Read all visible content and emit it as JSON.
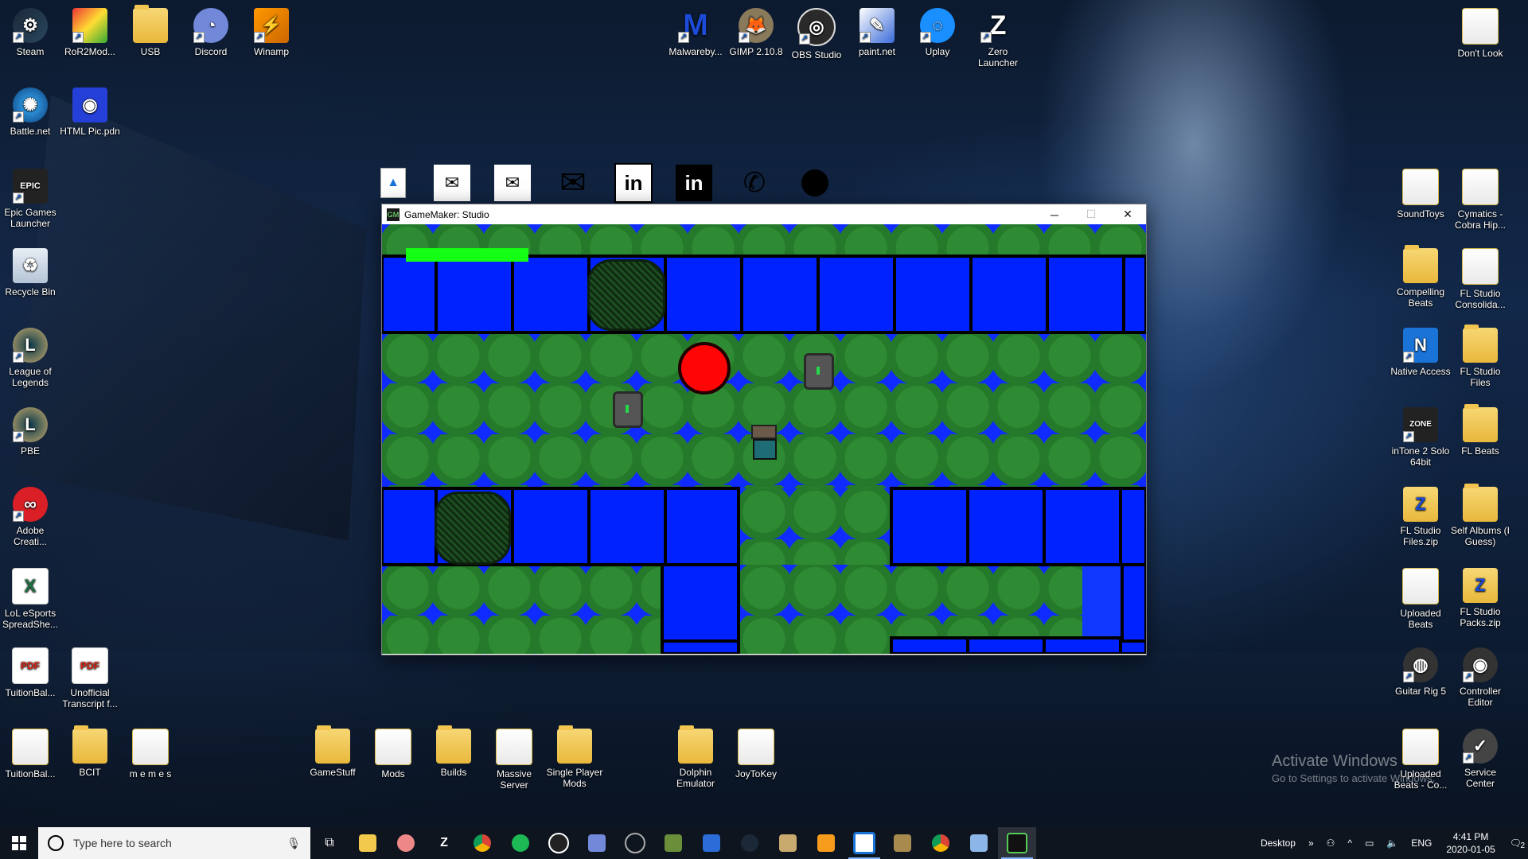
{
  "desktop_icons": {
    "steam": "Steam",
    "ror2mod": "RoR2Mod...",
    "usb": "USB",
    "discord": "Discord",
    "winamp": "Winamp",
    "malwarebytes": "Malwareby...",
    "gimp": "GIMP 2.10.8",
    "obs": "OBS Studio",
    "paintnet": "paint.net",
    "uplay": "Uplay",
    "zero_launcher": "Zero Launcher",
    "dont_look": "Don't Look",
    "battlenet": "Battle.net",
    "html_pic": "HTML Pic.pdn",
    "epic": "Epic Games Launcher",
    "recycle": "Recycle Bin",
    "lol": "League of Legends",
    "pbe": "PBE",
    "adobe": "Adobe Creati...",
    "lol_esports": "LoL eSports SpreadShe...",
    "tuition_pdf": "TuitionBal...",
    "unofficial_transcript": "Unofficial Transcript f...",
    "tuition_bottom": "TuitionBal...",
    "bcit": "BCIT",
    "memes": "m e m e s",
    "gamestuff": "GameStuff",
    "mods": "Mods",
    "builds": "Builds",
    "massive_server": "Massive Server",
    "single_player_mods": "Single Player Mods",
    "dolphin": "Dolphin Emulator",
    "joytokey": "JoyToKey",
    "soundtoys": "SoundToys",
    "cymatics": "Cymatics - Cobra Hip...",
    "compelling_beats": "Compelling Beats",
    "fl_consolidated": "FL Studio Consolida...",
    "native_access": "Native Access",
    "fl_files": "FL Studio Files",
    "intone": "inTone 2 Solo 64bit",
    "fl_beats": "FL Beats",
    "fl_files_zip": "FL Studio Files.zip",
    "self_albums": "Self Albums (I Guess)",
    "uploaded_beats": "Uploaded Beats",
    "fl_packs_zip": "FL Studio Packs.zip",
    "guitar_rig": "Guitar Rig 5",
    "controller_editor": "Controller Editor",
    "uploaded_beats_co": "Uploaded Beats - Co...",
    "service_center": "Service Center"
  },
  "window": {
    "title": "GameMaker: Studio",
    "minimize": "─",
    "maximize": "☐",
    "close": "✕"
  },
  "game": {
    "health_fraction": 1.0,
    "colors": {
      "health": "#14ff14",
      "water": "#0022ff",
      "grass": "#2e8b33",
      "enemy": "#ff0505"
    }
  },
  "taskbar": {
    "search_placeholder": "Type here to search",
    "desktop_label": "Desktop",
    "lang": "ENG",
    "time": "4:41 PM",
    "date": "2020-01-05",
    "notification_count": "2"
  },
  "watermark": {
    "line1": "Activate Windows",
    "line2": "Go to Settings to activate Windows."
  }
}
